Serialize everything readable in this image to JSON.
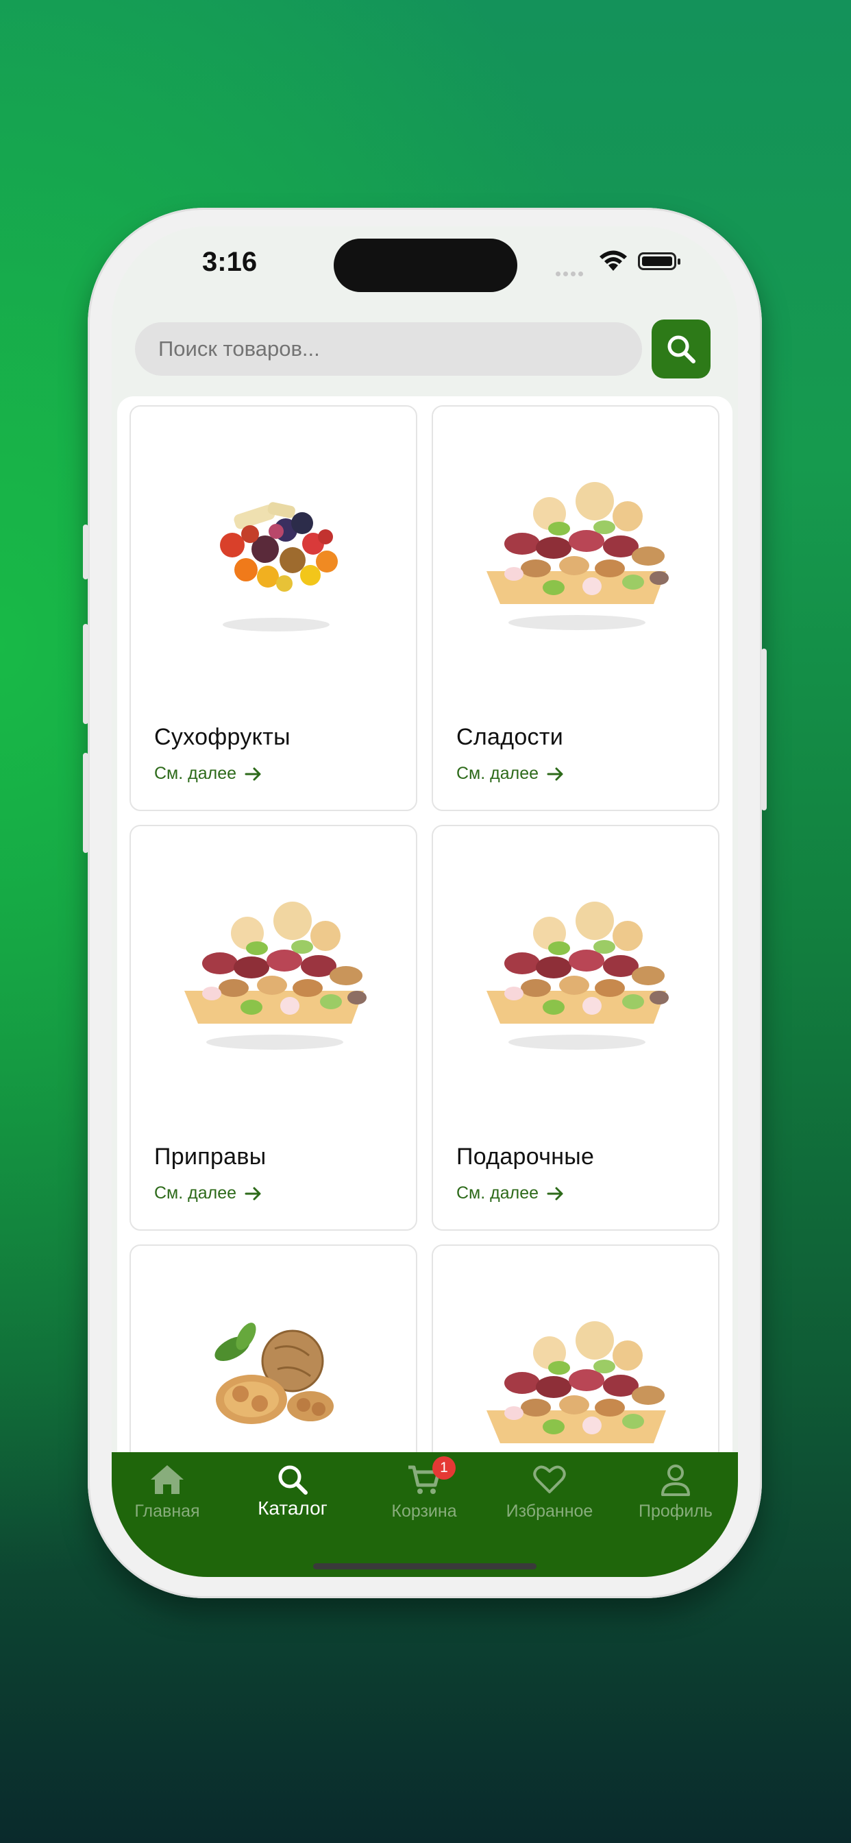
{
  "status": {
    "time": "3:16"
  },
  "search": {
    "placeholder": "Поиск товаров..."
  },
  "catalog": {
    "more_label": "См. далее",
    "categories": [
      {
        "title": "Сухофрукты",
        "image": "dried-fruits"
      },
      {
        "title": "Сладости",
        "image": "nut-mix"
      },
      {
        "title": "Приправы",
        "image": "nut-mix"
      },
      {
        "title": "Подарочные",
        "image": "nut-mix"
      },
      {
        "title": "",
        "image": "walnuts"
      },
      {
        "title": "",
        "image": "nut-mix"
      }
    ]
  },
  "tabbar": {
    "tabs": [
      {
        "label": "Главная",
        "icon": "home-icon"
      },
      {
        "label": "Каталог",
        "icon": "search-icon",
        "active": true
      },
      {
        "label": "Корзина",
        "icon": "cart-icon",
        "badge": "1"
      },
      {
        "label": "Избранное",
        "icon": "heart-icon"
      },
      {
        "label": "Профиль",
        "icon": "user-icon"
      }
    ]
  },
  "colors": {
    "accent": "#2d7a18",
    "tabbar": "#1f660b",
    "badge": "#e53935"
  }
}
